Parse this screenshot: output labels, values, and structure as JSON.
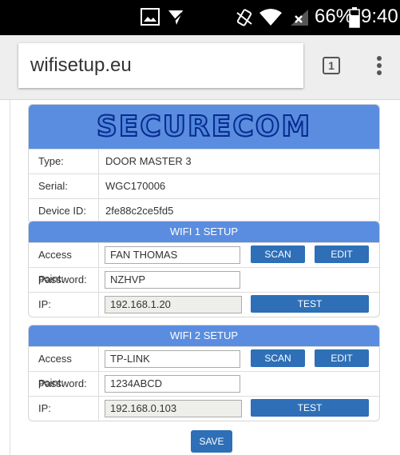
{
  "status_bar": {
    "battery_percent": "66%",
    "time": "9:40",
    "icons": [
      "image-icon",
      "check-sync-icon",
      "vibrate-icon",
      "wifi-icon",
      "signal-off-icon",
      "battery-icon"
    ]
  },
  "browser": {
    "url": "wifisetup.eu",
    "tab_count": "1"
  },
  "logo_text": "SECURECOM",
  "device": {
    "type_label": "Type:",
    "type_value": "DOOR MASTER 3",
    "serial_label": "Serial:",
    "serial_value": "WGC170006",
    "id_label": "Device ID:",
    "id_value": "2fe88c2ce5fd5"
  },
  "wifi1": {
    "title": "WIFI 1 SETUP",
    "ap_label": "Access point:",
    "ap_value": "FAN THOMAS",
    "pw_label": "Password:",
    "pw_value": "NZHVP",
    "ip_label": "IP:",
    "ip_value": "192.168.1.20",
    "scan_label": "SCAN",
    "edit_label": "EDIT",
    "test_label": "TEST"
  },
  "wifi2": {
    "title": "WIFI 2 SETUP",
    "ap_label": "Access point:",
    "ap_value": "TP-LINK",
    "pw_label": "Password:",
    "pw_value": "1234ABCD",
    "ip_label": "IP:",
    "ip_value": "192.168.0.103",
    "scan_label": "SCAN",
    "edit_label": "EDIT",
    "test_label": "TEST"
  },
  "save_label": "SAVE",
  "colors": {
    "accent": "#5a8de0",
    "button": "#2e6fb7",
    "status_bar": "#000000"
  }
}
